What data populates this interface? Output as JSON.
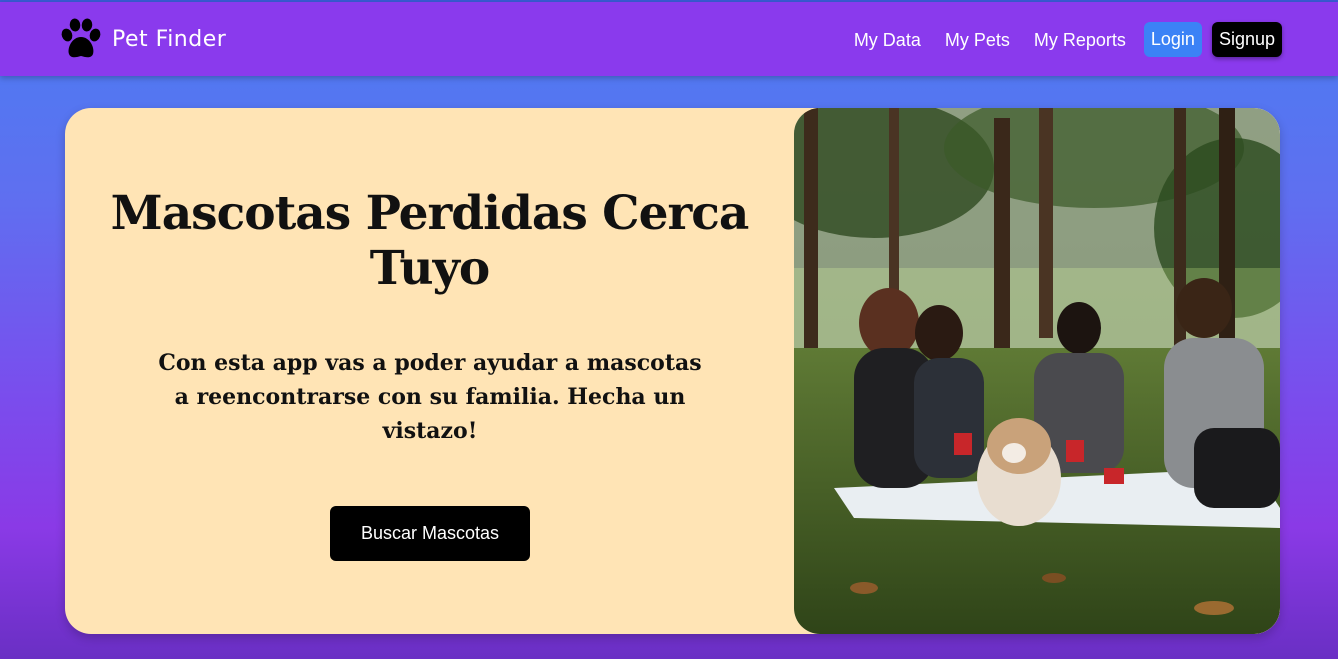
{
  "brand": {
    "name": "Pet Finder",
    "icon": "paw-icon"
  },
  "nav": {
    "links": [
      "My Data",
      "My Pets",
      "My Reports"
    ],
    "login_label": "Login",
    "signup_label": "Signup"
  },
  "hero": {
    "title": "Mascotas Perdidas Cerca Tuyo",
    "text": "Con esta app vas a poder ayudar a mascotas a reencontrarse con su familia. Hecha un vistazo!",
    "cta_label": "Buscar Mascotas"
  },
  "colors": {
    "navbar": "#8a3aed",
    "hero_bg": "#ffe4b5",
    "login_bg": "#3b82f6",
    "signup_bg": "#000000"
  }
}
